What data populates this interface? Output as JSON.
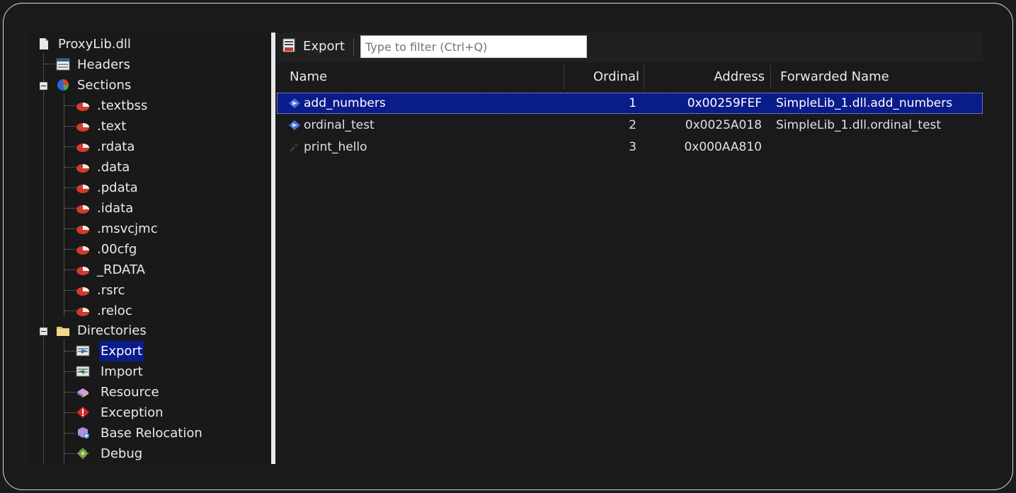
{
  "tree": {
    "root": "ProxyLib.dll",
    "headers": "Headers",
    "sections_label": "Sections",
    "sections": [
      ".textbss",
      ".text",
      ".rdata",
      ".data",
      ".pdata",
      ".idata",
      ".msvcjmc",
      ".00cfg",
      "_RDATA",
      ".rsrc",
      ".reloc"
    ],
    "directories_label": "Directories",
    "directories": [
      "Export",
      "Import",
      "Resource",
      "Exception",
      "Base Relocation",
      "Debug"
    ],
    "selected": "Export"
  },
  "toolbar": {
    "title": "Export",
    "filter_placeholder": "Type to filter (Ctrl+Q)"
  },
  "table": {
    "columns": [
      "Name",
      "Ordinal",
      "Address",
      "Forwarded Name"
    ],
    "rows": [
      {
        "name": "add_numbers",
        "ordinal": "1",
        "address": "0x00259FEF",
        "forwarded": "SimpleLib_1.dll.add_numbers",
        "selected": true
      },
      {
        "name": "ordinal_test",
        "ordinal": "2",
        "address": "0x0025A018",
        "forwarded": "SimpleLib_1.dll.ordinal_test",
        "selected": false
      },
      {
        "name": "print_hello",
        "ordinal": "3",
        "address": "0x000AA810",
        "forwarded": "",
        "selected": false
      }
    ]
  },
  "colors": {
    "background": "#1b1b1b",
    "selection": "#0a1b8a",
    "frame": "#d9d9d9"
  }
}
